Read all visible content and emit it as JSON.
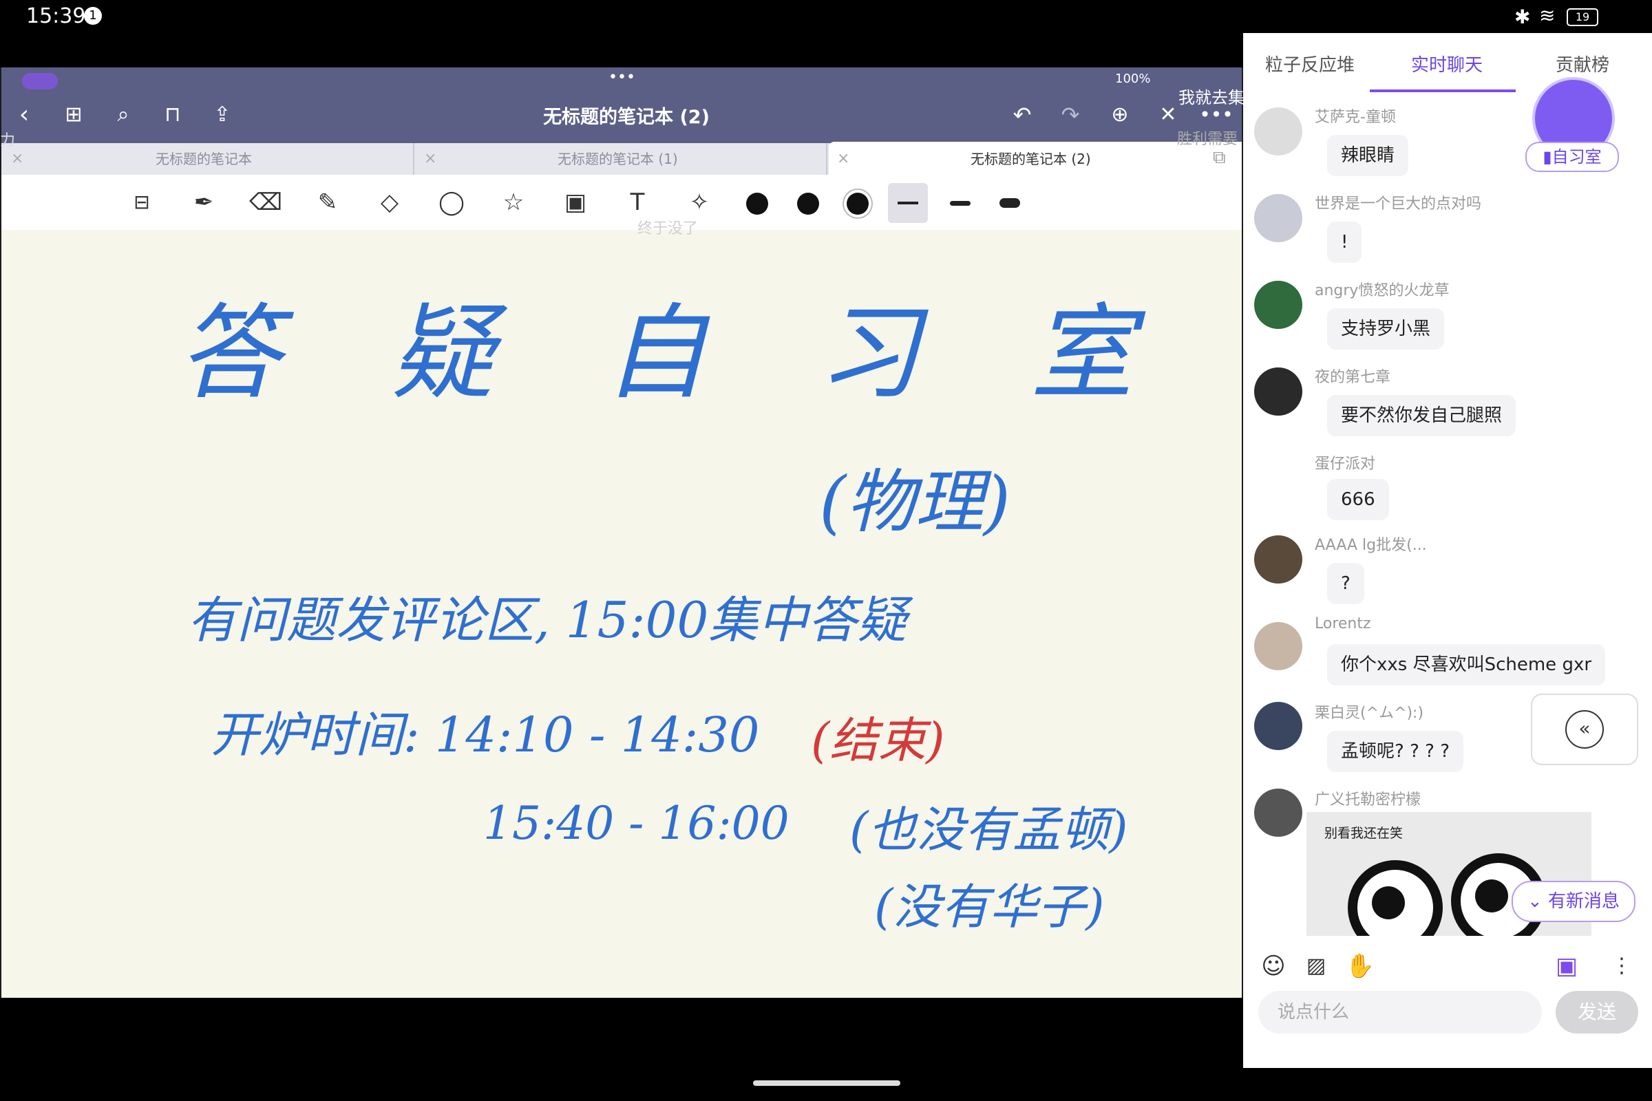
{
  "status_bar": {
    "time": "15:39",
    "notification_count": "1",
    "battery": "19"
  },
  "notebook": {
    "mini_status": "100%",
    "title": "无标题的笔记本 (2)",
    "tabs": [
      {
        "label": "无标题的笔记本"
      },
      {
        "label": "无标题的笔记本 (1)"
      },
      {
        "label": "无标题的笔记本 (2)"
      }
    ],
    "handwriting": {
      "title": "答 疑 自 习 室",
      "subtitle": "(物理)",
      "line1": "有问题发评论区, 15:00集中答疑",
      "line2_prefix": "开炉时间: 14:10 - 14:30",
      "line2_red": "(结束)",
      "line3": "15:40 - 16:00",
      "line3_note": "(也没有孟顿)",
      "line4_note": "(没有华子)"
    },
    "overlays": {
      "danmaku_1": "我就去集",
      "danmaku_2": "胜利需要",
      "danmaku_3": "终于没了",
      "danmaku_4": "力"
    }
  },
  "chat": {
    "tabs": [
      "粒子反应堆",
      "实时聊天",
      "贡献榜"
    ],
    "active_tab": 1,
    "room_badge": "自习室",
    "messages": [
      {
        "user": "艾萨克-童顿",
        "text": "辣眼睛"
      },
      {
        "user": "世界是一个巨大的点对吗",
        "text": "!"
      },
      {
        "user": "angry愤怒的火龙草",
        "text": "支持罗小黑"
      },
      {
        "user": "夜的第七章",
        "text": "要不然你发自己腿照"
      },
      {
        "user": "蛋仔派对",
        "text": "666"
      },
      {
        "user": "AAAA lg批发(...",
        "text": "?"
      },
      {
        "user": "Lorentz",
        "text": "你个xxs 尽喜欢叫Scheme gxr"
      },
      {
        "user": "栗白灵(^ム^):)",
        "text": "孟顿呢? ? ? ?"
      },
      {
        "user": "广义托勒密柠檬",
        "text": ""
      }
    ],
    "meme_caption": "别看我还在笑",
    "new_message_label": "有新消息",
    "input_placeholder": "说点什么",
    "send_label": "发送"
  }
}
